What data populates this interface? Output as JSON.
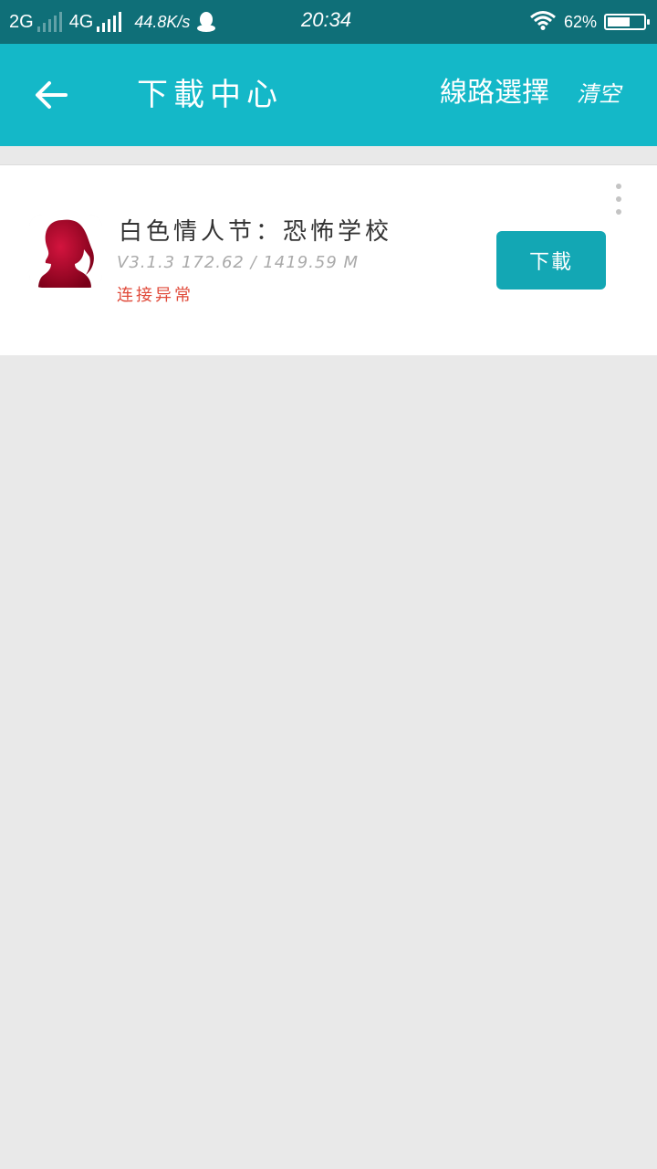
{
  "status_bar": {
    "net1": "2G",
    "net2": "4G",
    "speed": "44.8K/s",
    "time": "20:34",
    "battery_text": "62%",
    "battery_level": 0.62,
    "icons": [
      "signal-bars-icon",
      "qq-penguin-icon",
      "wifi-icon",
      "battery-icon"
    ]
  },
  "header": {
    "back_icon": "arrow-left-icon",
    "title": "下載中心",
    "route_label": "線路選擇",
    "clear_label": "清空"
  },
  "downloads": [
    {
      "name": "白色情人节：恐怖学校",
      "version": "V3.1.3",
      "progress_text": "172.62 / 1419.59 M",
      "status": "连接异常",
      "button_label": "下載",
      "icon": "girl-silhouette-icon"
    }
  ],
  "colors": {
    "status_bar": "#0f6f78",
    "app_bar": "#14b8c8",
    "button": "#13a7b4",
    "status_error": "#e04a3a",
    "background": "#e9e9e9"
  }
}
